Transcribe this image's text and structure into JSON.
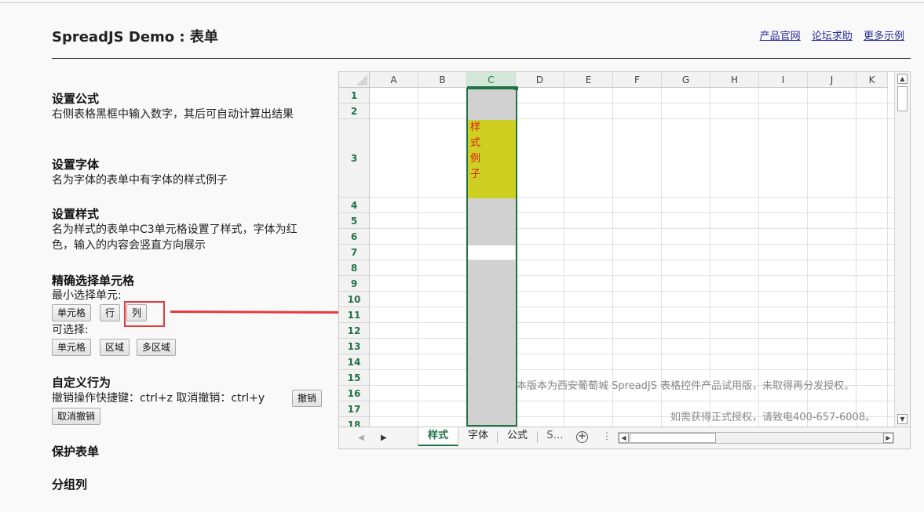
{
  "header": {
    "title": "SpreadJS Demo : 表单",
    "links": [
      "产品官网",
      "论坛求助",
      "更多示例"
    ]
  },
  "sections": {
    "formula": {
      "title": "设置公式",
      "text": "右侧表格黑框中输入数字，其后可自动计算出结果"
    },
    "font": {
      "title": "设置字体",
      "text": "名为字体的表单中有字体的样式例子"
    },
    "style": {
      "title": "设置样式",
      "text": "名为样式的表单中C3单元格设置了样式，字体为红色，输入的内容会竖直方向展示"
    },
    "select": {
      "title": "精确选择单元格",
      "min_label": "最小选择单元:",
      "min_buttons": [
        "单元格",
        "行",
        "列"
      ],
      "can_label": "可选择:",
      "can_buttons": [
        "单元格",
        "区域",
        "多区域"
      ]
    },
    "custom": {
      "title": "自定义行为",
      "text": "撤销操作快捷键：ctrl+z 取消撤销：ctrl+y",
      "undo_label": "撤销",
      "redo_label": "取消撤销"
    },
    "protect": {
      "title": "保护表单"
    },
    "group": {
      "title": "分组列"
    }
  },
  "sheet": {
    "columns": [
      "A",
      "B",
      "C",
      "D",
      "E",
      "F",
      "G",
      "H",
      "I",
      "J",
      "K"
    ],
    "selected_column": "C",
    "rows": [
      "1",
      "2",
      "3",
      "4",
      "5",
      "6",
      "7",
      "8",
      "9",
      "10",
      "11",
      "12",
      "13",
      "14",
      "15",
      "16",
      "17",
      "18"
    ],
    "c3_text": "样式例子",
    "watermark_line1": "本版本为西安葡萄城 SpreadJS 表格控件产品试用版，未取得再分发授权。",
    "watermark_line2": "如需获得正式授权，请致电400-657-6008。",
    "tabs": [
      "样式",
      "字体",
      "公式",
      "S…"
    ],
    "active_tab": "样式",
    "add_tab_icon": "plus-circle-icon"
  }
}
